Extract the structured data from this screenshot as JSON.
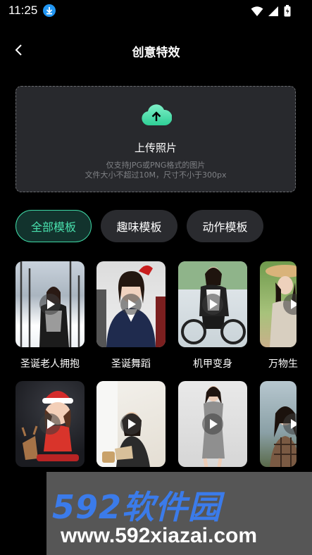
{
  "status_bar": {
    "time": "11:25"
  },
  "header": {
    "title": "创意特效"
  },
  "upload": {
    "title": "上传照片",
    "hint_line1": "仅支持JPG或PNG格式的图片",
    "hint_line2": "文件大小不超过10M，尺寸不小于300px"
  },
  "tabs": [
    {
      "label": "全部模板",
      "active": true
    },
    {
      "label": "趣味模板",
      "active": false
    },
    {
      "label": "动作模板",
      "active": false
    }
  ],
  "templates_row1": [
    {
      "label": "圣诞老人拥抱",
      "thumb": "snowy-park-woman"
    },
    {
      "label": "圣诞舞蹈",
      "thumb": "santa-hat-woman"
    },
    {
      "label": "机甲变身",
      "thumb": "cycling-woman"
    },
    {
      "label": "万物生",
      "thumb": "straw-hat-woman"
    }
  ],
  "templates_row2": [
    {
      "thumb": "christmas-3d-girl"
    },
    {
      "thumb": "reading-woman"
    },
    {
      "thumb": "grey-dress-woman"
    },
    {
      "thumb": "plaid-jacket-woman"
    }
  ],
  "watermark": {
    "brand": "592软件园",
    "url": "www.592xiazai.com"
  },
  "colors": {
    "accent": "#49e0ad",
    "background": "#000000",
    "panel": "#28292d",
    "watermark_blue": "#3b7bea"
  }
}
